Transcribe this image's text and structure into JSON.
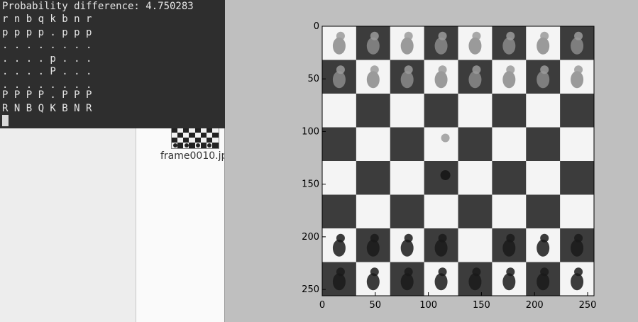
{
  "terminal": {
    "lines": [
      "Probability difference: 4.750283",
      "r n b q k b n r",
      "p p p p . p p p",
      ". . . . . . . .",
      ". . . . p . . .",
      ". . . . P . . .",
      ". . . . . . . .",
      "P P P P . P P P",
      "R N B Q K B N R"
    ]
  },
  "file_manager": {
    "thumbnail_label": "frame0010.jp"
  },
  "plot": {
    "x_ticks": [
      "0",
      "50",
      "100",
      "150",
      "200",
      "250"
    ],
    "y_ticks": [
      "0",
      "50",
      "100",
      "150",
      "200",
      "250"
    ],
    "x_range": [
      0,
      256
    ],
    "y_range": [
      0,
      256
    ],
    "colors": {
      "light_square": "#f4f4f4",
      "dark_square": "#3c3c3c",
      "piece": "#1a1a1a",
      "figure_bg": "#bfbfbf"
    }
  }
}
